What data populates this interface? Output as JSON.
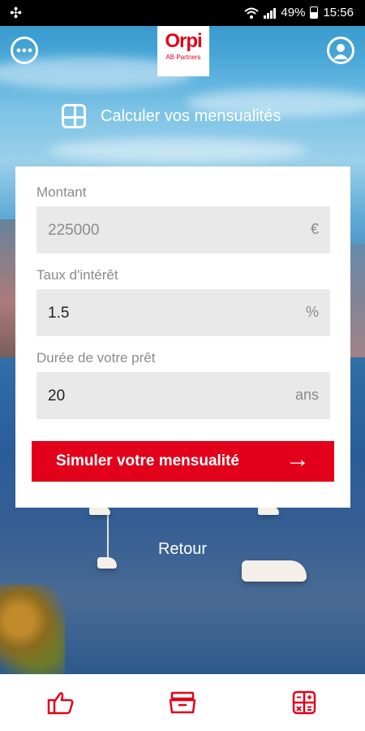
{
  "status_bar": {
    "battery": "49%",
    "time": "15:56"
  },
  "header": {
    "logo_brand": "Orpi",
    "logo_subtitle": "AB Partners"
  },
  "page": {
    "title": "Calculer vos mensualités"
  },
  "form": {
    "amount": {
      "label": "Montant",
      "value": "225000",
      "unit": "€"
    },
    "rate": {
      "label": "Taux d'intérêt",
      "value": "1.5",
      "unit": "%"
    },
    "duration": {
      "label": "Durée de votre prêt",
      "value": "20",
      "unit": "ans"
    },
    "submit_label": "Simuler votre mensualité"
  },
  "back_label": "Retour",
  "bottom_nav": {
    "items": [
      {
        "icon": "thumbs-up-icon"
      },
      {
        "icon": "folder-icon"
      },
      {
        "icon": "calculator-icon"
      }
    ]
  },
  "colors": {
    "accent": "#e2001a",
    "field_bg": "#e9e9e9"
  }
}
